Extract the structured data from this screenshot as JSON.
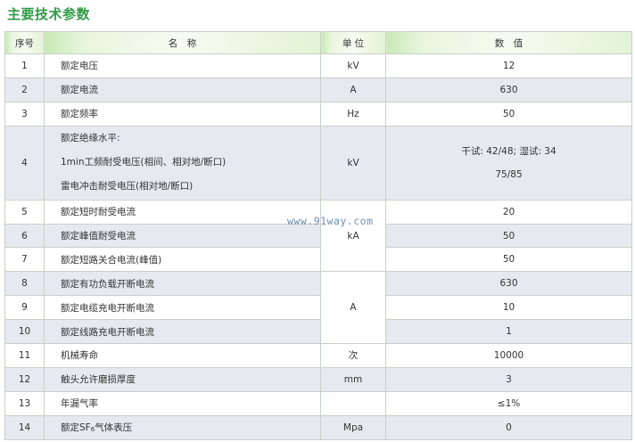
{
  "title": "主要技术参数",
  "header": {
    "idx": "序号",
    "name": "名　称",
    "unit": "单 位",
    "value": "数　值"
  },
  "rows": [
    {
      "idx": "1",
      "name": "额定电压",
      "unit": "kV",
      "value": "12"
    },
    {
      "idx": "2",
      "name": "额定电流",
      "unit": "A",
      "value": "630"
    },
    {
      "idx": "3",
      "name": "额定频率",
      "unit": "Hz",
      "value": "50"
    },
    {
      "idx": "4",
      "name_lines": [
        "额定绝缘水平:",
        "1min工频耐受电压(相间、相对地/断口)",
        "雷电冲击耐受电压(相对地/断口)"
      ],
      "unit": "kV",
      "value_lines": [
        "干试: 42/48; 湿试: 34",
        "75/85"
      ]
    },
    {
      "idx": "5",
      "name": "额定短时耐受电流",
      "value": "20"
    },
    {
      "idx": "6",
      "name": "额定峰值耐受电流",
      "value": "50"
    },
    {
      "idx": "7",
      "name": "额定短路关合电流(峰值)",
      "value": "50"
    },
    {
      "idx": "8",
      "name": "额定有功负载开断电流",
      "value": "630"
    },
    {
      "idx": "9",
      "name": "额定电缆充电开断电流",
      "value": "10"
    },
    {
      "idx": "10",
      "name": "额定线路充电开断电流",
      "value": "1"
    },
    {
      "idx": "11",
      "name": "机械寿命",
      "unit": "次",
      "value": "10000"
    },
    {
      "idx": "12",
      "name": "触头允许磨损厚度",
      "unit": "mm",
      "value": "3"
    },
    {
      "idx": "13",
      "name": "年漏气率",
      "unit": "",
      "value": "≤1%"
    },
    {
      "idx": "14",
      "name_parts": [
        "额定SF",
        "6",
        "气体表压"
      ],
      "unit": "Mpa",
      "value": "0"
    }
  ],
  "merged_units": {
    "rows_5_7": "kA",
    "rows_8_10": "A"
  },
  "watermark": "www.91way.com"
}
